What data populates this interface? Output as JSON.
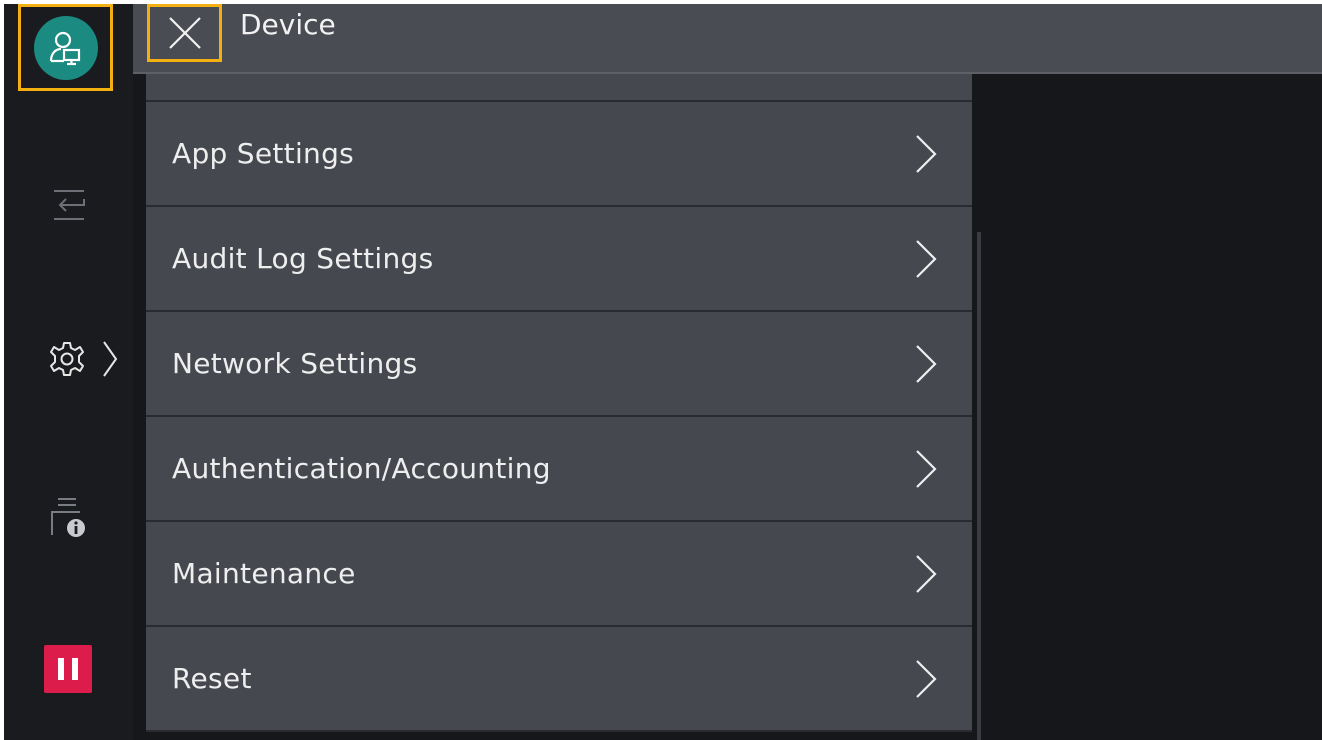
{
  "header": {
    "title": "Device"
  },
  "rail": {
    "items": [
      {
        "name": "user-icon"
      },
      {
        "name": "job-transfer-icon"
      },
      {
        "name": "gear-icon"
      },
      {
        "name": "device-info-icon"
      },
      {
        "name": "stop-icon"
      }
    ]
  },
  "menu": {
    "items": [
      {
        "label": "App Settings"
      },
      {
        "label": "Audit Log Settings"
      },
      {
        "label": "Network Settings"
      },
      {
        "label": "Authentication/Accounting"
      },
      {
        "label": "Maintenance"
      },
      {
        "label": "Reset"
      }
    ]
  },
  "colors": {
    "accent_highlight": "#f4b010",
    "avatar": "#1b8a80",
    "stop": "#dc1d4b",
    "list_item": "#464850",
    "background": "#16171b"
  }
}
